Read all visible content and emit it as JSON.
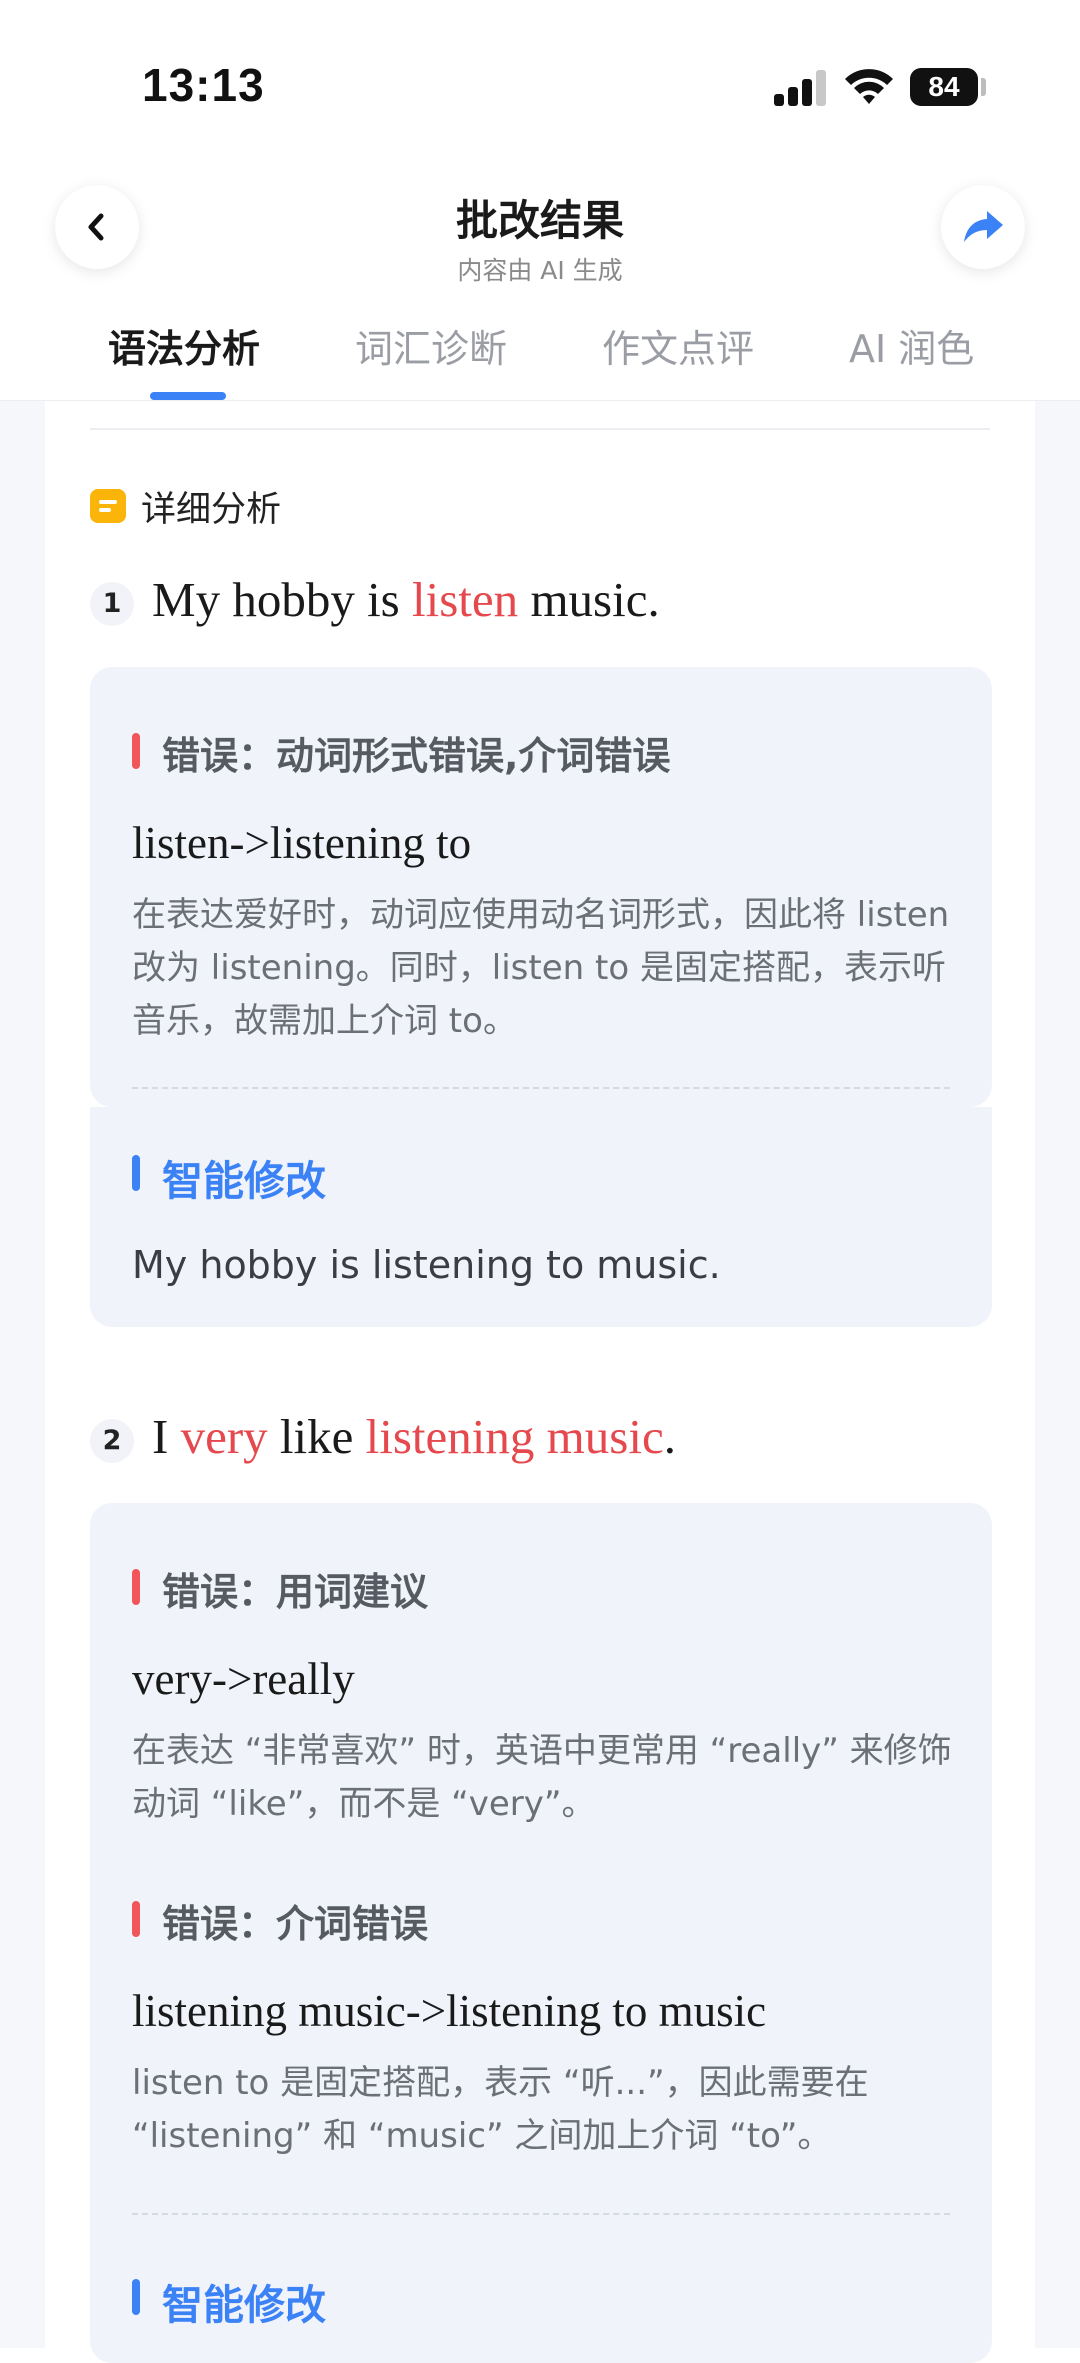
{
  "status_bar": {
    "time": "13:13",
    "battery": "84"
  },
  "header": {
    "title": "批改结果",
    "subtitle": "内容由 AI 生成"
  },
  "tabs": [
    {
      "label": "语法分析",
      "active": true
    },
    {
      "label": "词汇诊断",
      "active": false
    },
    {
      "label": "作文点评",
      "active": false
    },
    {
      "label": "AI 润色",
      "active": false
    }
  ],
  "section": {
    "title": "详细分析"
  },
  "items": [
    {
      "number": "1",
      "sentence_parts": [
        "My hobby is ",
        "listen",
        " music."
      ],
      "errors": [
        {
          "label": "错误：动词形式错误,介词错误",
          "correction": "listen->listening to",
          "explanation": "在表达爱好时，动词应使用动名词形式，因此将 listen 改为 listening。同时，listen to 是固定搭配，表示听音乐，故需加上介词 to。"
        }
      ],
      "fix_label": "智能修改",
      "fixed_sentence": "My hobby is listening to music."
    },
    {
      "number": "2",
      "sentence_parts": [
        "I ",
        "very",
        " like ",
        "listening music",
        "."
      ],
      "errors": [
        {
          "label": "错误：用词建议",
          "correction": "very->really",
          "explanation": "在表达 “非常喜欢” 时，英语中更常用 “really” 来修饰动词 “like”，而不是 “very”。"
        },
        {
          "label": "错误：介词错误",
          "correction": "listening music->listening to music",
          "explanation": "listen to 是固定搭配，表示 “听...”，因此需要在 “listening” 和 “music” 之间加上介词 “to”。"
        }
      ],
      "fix_label": "智能修改"
    }
  ],
  "colors": {
    "accent": "#3b82f6",
    "error": "#e5484d",
    "section_icon": "#fbb40a",
    "analysis_bg": "#f0f3fa"
  },
  "icons": {
    "back": "chevron-left-icon",
    "share": "share-arrow-icon",
    "section": "note-icon"
  }
}
